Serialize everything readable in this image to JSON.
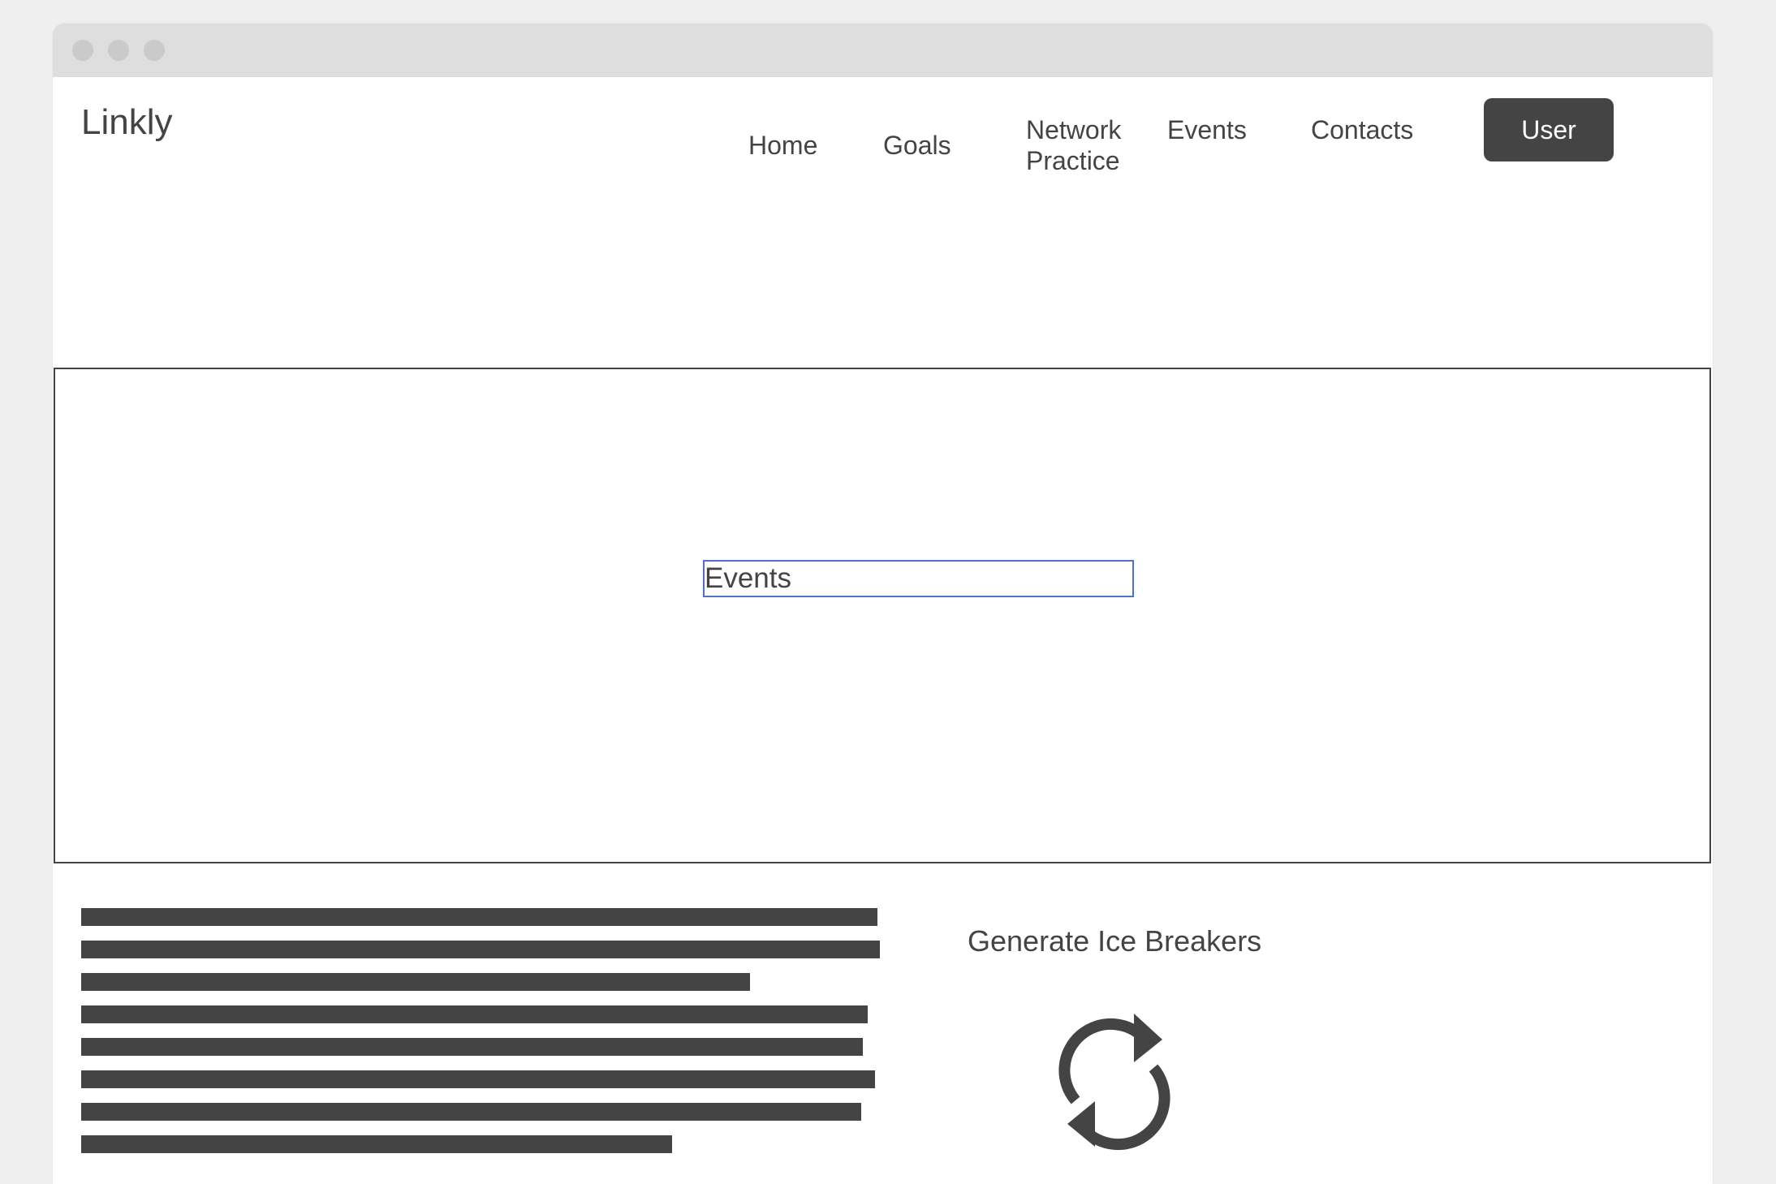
{
  "app": {
    "logo": "Linkly"
  },
  "nav": {
    "home": "Home",
    "goals": "Goals",
    "network_practice_line1": "Network",
    "network_practice_line2": "Practice",
    "events": "Events",
    "contacts": "Contacts",
    "user_button": "User"
  },
  "hero": {
    "field_value": "Events"
  },
  "ice_breakers": {
    "title": "Generate Ice Breakers",
    "refresh_icon": "refresh-icon"
  },
  "colors": {
    "text": "#444444",
    "button_bg": "#444444",
    "field_border": "#4e72c9",
    "titlebar": "#dedede"
  }
}
